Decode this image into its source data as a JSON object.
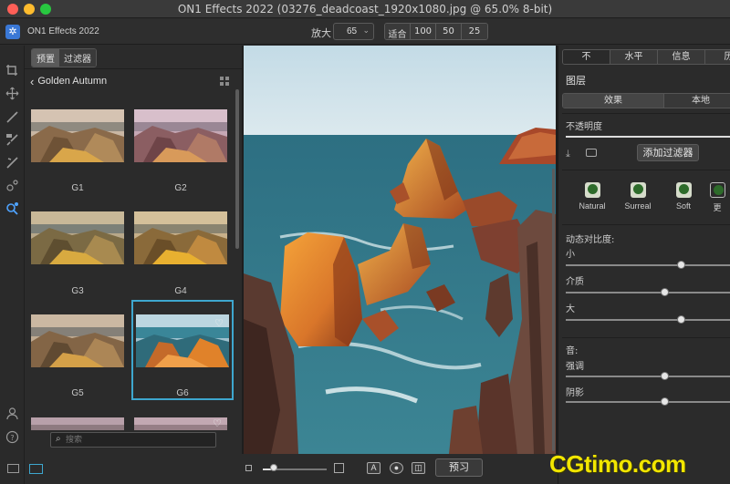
{
  "window": {
    "title": "ON1 Effects 2022 (03276_deadcoast_1920x1080.jpg @ 65.0% 8-bit)"
  },
  "toolbar": {
    "app_name": "ON1 Effects 2022",
    "zoom_label": "放大",
    "zoom_value": "65",
    "zoom_options": [
      "适合",
      "100",
      "50",
      "25"
    ]
  },
  "browser": {
    "tabs": [
      {
        "label": "预置",
        "active": true
      },
      {
        "label": "过滤器",
        "active": false
      }
    ],
    "category_title": "Golden Autumn",
    "presets": [
      {
        "label": "G1"
      },
      {
        "label": "G2"
      },
      {
        "label": "G3"
      },
      {
        "label": "G4"
      },
      {
        "label": "G5"
      },
      {
        "label": "G6",
        "selected": true
      }
    ],
    "search_placeholder": "搜索"
  },
  "canvas": {
    "preview_button": "预习"
  },
  "right_panel": {
    "tabs": [
      "不",
      "水平",
      "信息",
      "历"
    ],
    "layers_title": "图层",
    "fx_tabs": [
      "效果",
      "本地"
    ],
    "opacity_label": "不透明度",
    "opacity_value": 1.0,
    "add_filter_button": "添加过滤器",
    "looks": [
      {
        "label": "Natural"
      },
      {
        "label": "Surreal"
      },
      {
        "label": "Soft"
      },
      {
        "label": "更"
      }
    ],
    "dynamic_contrast": {
      "title": "动态对比度:",
      "sliders": [
        {
          "label": "小",
          "value": 0.7
        },
        {
          "label": "介质",
          "value": 0.6
        },
        {
          "label": "大",
          "value": 0.7
        }
      ]
    },
    "tone": {
      "title": "音:",
      "sliders": [
        {
          "label": "强调",
          "value": 0.6
        },
        {
          "label": "阴影",
          "value": 0.6
        }
      ]
    }
  },
  "watermark": "CGtimo.com",
  "colors": {
    "accent": "#3ea7cf",
    "panel_bg": "#2b2b2b",
    "watermark": "#f2e600"
  }
}
